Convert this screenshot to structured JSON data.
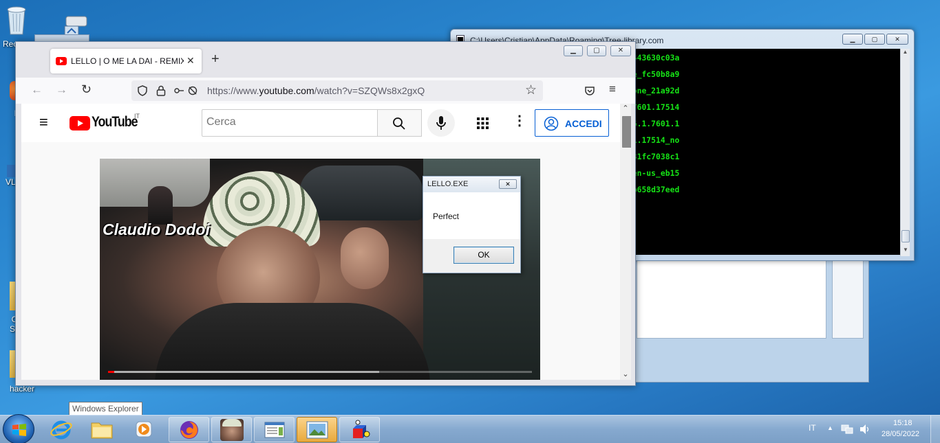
{
  "desktop": {
    "icons": [
      {
        "label": "Rec",
        "glyph": "recycle-bin-icon"
      },
      {
        "label": "hacker",
        "glyph": "folder-icon"
      }
    ],
    "fragments": [
      "F",
      "VL",
      "C",
      "Sc"
    ]
  },
  "console": {
    "title": "C:\\Users\\Cristian\\AppData\\Roaming\\Tree-library.com",
    "lines": [
      "856ad364e35_6.1.7601.17514_none_6007c443630c03a",
      "i_31bf3856ad364e35_6.1.7600.16385_none_fc50b8a9",
      "s_i_31bf3856ad364e35_6.1.7600.16385_none_21a92d",
      "flow.activities_31bf3856ad364e35_6.1.7601.17514",
      "flow.componentmodel_31bf3856ad364e35_6.1.7601.1",
      "flow.runtime_31bf3856ad364e35_6.1.7601.17514_no",
      "3856ad364e35_6.1.7600.16385_none_7f4231fc7038c1",
      "rces_31bf3856ad364e35_6.1.7600.16385_en-us_eb15",
      "856ad364e35_6.1.7600.16385_none_0fa07b658d37eed"
    ],
    "color": "#16e316"
  },
  "firefox": {
    "tab_title": "LELLO | O ME LA DAI - REMIX -",
    "new_tab": "+",
    "url_prefix": "https://www.",
    "url_domain": "youtube.com",
    "url_path": "/watch?v=SZQWs8x2gxQ"
  },
  "youtube": {
    "logo_text": "YouTube",
    "country": "IT",
    "search_placeholder": "Cerca",
    "signin_label": "ACCEDI",
    "brand_color": "#ff0000",
    "video_overlay_name": "Claudio Dodoi",
    "progress": 0.015,
    "buffered": 0.64
  },
  "dialog": {
    "title": "LELLO.EXE",
    "message": "Perfect",
    "ok_label": "OK"
  },
  "taskbar": {
    "tooltip": "Windows Explorer",
    "language": "IT",
    "time": "15:18",
    "date": "28/05/2022"
  }
}
